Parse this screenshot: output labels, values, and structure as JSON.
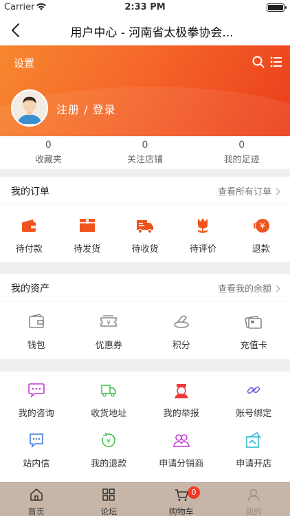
{
  "status_bar": {
    "carrier": "Carrier",
    "time": "2:33 PM"
  },
  "nav": {
    "title": "用户中心 - 河南省太极拳协会..."
  },
  "header": {
    "settings_label": "设置",
    "login_label": "注册 / 登录"
  },
  "stats": [
    {
      "value": "0",
      "label": "收藏夹"
    },
    {
      "value": "0",
      "label": "关注店铺"
    },
    {
      "value": "0",
      "label": "我的足迹"
    }
  ],
  "orders": {
    "title": "我的订单",
    "link": "查看所有订单",
    "items": [
      {
        "label": "待付款",
        "icon": "wallet-icon"
      },
      {
        "label": "待发货",
        "icon": "box-icon"
      },
      {
        "label": "待收货",
        "icon": "truck-icon"
      },
      {
        "label": "待评价",
        "icon": "flower-icon"
      },
      {
        "label": "退款",
        "icon": "refund-icon"
      }
    ]
  },
  "assets": {
    "title": "我的资产",
    "link": "查看我的余额",
    "items": [
      {
        "label": "钱包",
        "icon": "wallet-outline-icon"
      },
      {
        "label": "优惠券",
        "icon": "coupon-icon"
      },
      {
        "label": "积分",
        "icon": "points-icon"
      },
      {
        "label": "充值卡",
        "icon": "card-icon"
      }
    ]
  },
  "services": {
    "items": [
      {
        "label": "我的咨询",
        "icon": "chat-icon",
        "color": "#c23ad6"
      },
      {
        "label": "收货地址",
        "icon": "delivery-icon",
        "color": "#3fc44d"
      },
      {
        "label": "我的举报",
        "icon": "police-icon",
        "color": "#ef3b3b"
      },
      {
        "label": "账号绑定",
        "icon": "link-icon",
        "color": "#7b5bd9"
      },
      {
        "label": "站内信",
        "icon": "message-icon",
        "color": "#3a79e0"
      },
      {
        "label": "我的退款",
        "icon": "refund-circle-icon",
        "color": "#3fc44d"
      },
      {
        "label": "申请分销商",
        "icon": "people-icon",
        "color": "#c23ad6"
      },
      {
        "label": "申请开店",
        "icon": "shop-icon",
        "color": "#2fb9d6"
      }
    ]
  },
  "tabbar": {
    "items": [
      {
        "label": "首页",
        "icon": "home-icon"
      },
      {
        "label": "论坛",
        "icon": "grid-icon"
      },
      {
        "label": "购物车",
        "icon": "cart-icon",
        "badge": "0"
      },
      {
        "label": "我的",
        "icon": "user-icon"
      }
    ]
  },
  "colors": {
    "accent": "#f5672a",
    "order_icon": "#f0541e",
    "tabbar_bg": "#c7b6a8",
    "badge": "#ef3b2a"
  }
}
